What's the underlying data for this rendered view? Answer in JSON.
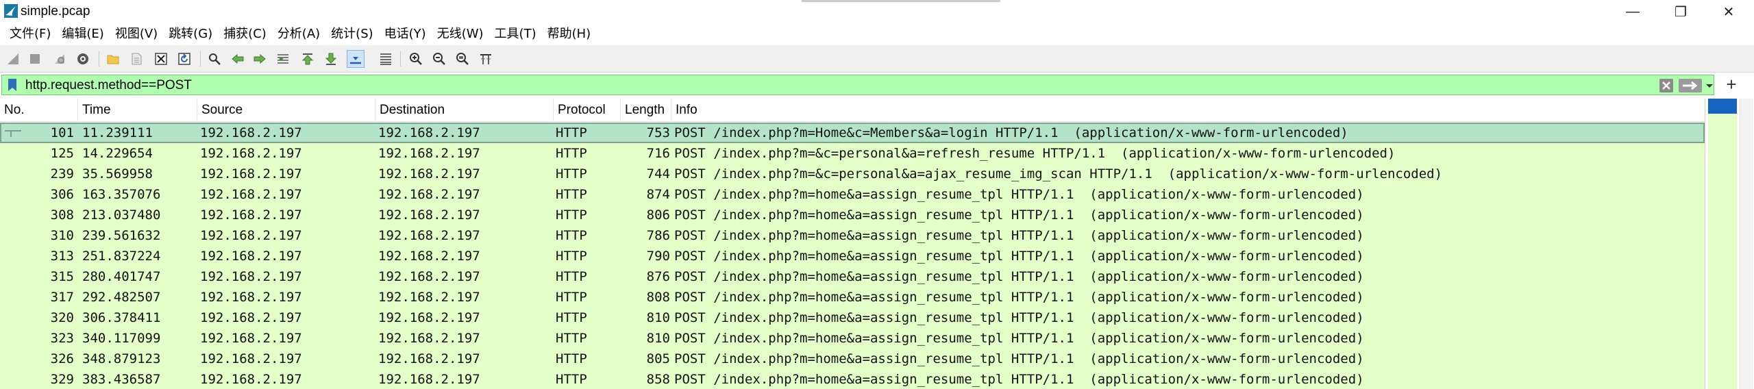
{
  "window": {
    "title": "simple.pcap",
    "minimize": "—",
    "maximize": "❐",
    "close": "✕"
  },
  "menu": [
    "文件(F)",
    "编辑(E)",
    "视图(V)",
    "跳转(G)",
    "捕获(C)",
    "分析(A)",
    "统计(S)",
    "电话(Y)",
    "无线(W)",
    "工具(T)",
    "帮助(H)"
  ],
  "toolbar_icons": [
    "shark-fin-start-icon",
    "stop-icon",
    "restart-icon",
    "capture-options-icon",
    "open-folder-icon",
    "file-icon",
    "close-file-icon",
    "reload-icon",
    "find-icon",
    "back-icon",
    "forward-icon",
    "goto-packet-icon",
    "first-packet-icon",
    "last-packet-icon",
    "autoscroll-icon",
    "colorize-icon",
    "zoom-in-icon",
    "zoom-out-icon",
    "zoom-reset-icon",
    "resize-columns-icon"
  ],
  "filter": {
    "value": "http.request.method==POST",
    "background": "#afffaf"
  },
  "columns": [
    "No.",
    "Time",
    "Source",
    "Destination",
    "Protocol",
    "Length",
    "Info"
  ],
  "colors": {
    "row_bg": "#e4ffc7",
    "selected_bg": "#b3e4c8",
    "minimap_mark": "#1565c0"
  },
  "packets": [
    {
      "no": "101",
      "time": "11.239111",
      "src": "192.168.2.197",
      "dst": "192.168.2.197",
      "proto": "HTTP",
      "len": "753",
      "info": "POST /index.php?m=Home&c=Members&a=login HTTP/1.1  (application/x-www-form-urlencoded)"
    },
    {
      "no": "125",
      "time": "14.229654",
      "src": "192.168.2.197",
      "dst": "192.168.2.197",
      "proto": "HTTP",
      "len": "716",
      "info": "POST /index.php?m=&c=personal&a=refresh_resume HTTP/1.1  (application/x-www-form-urlencoded)"
    },
    {
      "no": "239",
      "time": "35.569958",
      "src": "192.168.2.197",
      "dst": "192.168.2.197",
      "proto": "HTTP",
      "len": "744",
      "info": "POST /index.php?m=&c=personal&a=ajax_resume_img_scan HTTP/1.1  (application/x-www-form-urlencoded)"
    },
    {
      "no": "306",
      "time": "163.357076",
      "src": "192.168.2.197",
      "dst": "192.168.2.197",
      "proto": "HTTP",
      "len": "874",
      "info": "POST /index.php?m=home&a=assign_resume_tpl HTTP/1.1  (application/x-www-form-urlencoded)"
    },
    {
      "no": "308",
      "time": "213.037480",
      "src": "192.168.2.197",
      "dst": "192.168.2.197",
      "proto": "HTTP",
      "len": "806",
      "info": "POST /index.php?m=home&a=assign_resume_tpl HTTP/1.1  (application/x-www-form-urlencoded)"
    },
    {
      "no": "310",
      "time": "239.561632",
      "src": "192.168.2.197",
      "dst": "192.168.2.197",
      "proto": "HTTP",
      "len": "786",
      "info": "POST /index.php?m=home&a=assign_resume_tpl HTTP/1.1  (application/x-www-form-urlencoded)"
    },
    {
      "no": "313",
      "time": "251.837224",
      "src": "192.168.2.197",
      "dst": "192.168.2.197",
      "proto": "HTTP",
      "len": "790",
      "info": "POST /index.php?m=home&a=assign_resume_tpl HTTP/1.1  (application/x-www-form-urlencoded)"
    },
    {
      "no": "315",
      "time": "280.401747",
      "src": "192.168.2.197",
      "dst": "192.168.2.197",
      "proto": "HTTP",
      "len": "876",
      "info": "POST /index.php?m=home&a=assign_resume_tpl HTTP/1.1  (application/x-www-form-urlencoded)"
    },
    {
      "no": "317",
      "time": "292.482507",
      "src": "192.168.2.197",
      "dst": "192.168.2.197",
      "proto": "HTTP",
      "len": "808",
      "info": "POST /index.php?m=home&a=assign_resume_tpl HTTP/1.1  (application/x-www-form-urlencoded)"
    },
    {
      "no": "320",
      "time": "306.378411",
      "src": "192.168.2.197",
      "dst": "192.168.2.197",
      "proto": "HTTP",
      "len": "810",
      "info": "POST /index.php?m=home&a=assign_resume_tpl HTTP/1.1  (application/x-www-form-urlencoded)"
    },
    {
      "no": "323",
      "time": "340.117099",
      "src": "192.168.2.197",
      "dst": "192.168.2.197",
      "proto": "HTTP",
      "len": "810",
      "info": "POST /index.php?m=home&a=assign_resume_tpl HTTP/1.1  (application/x-www-form-urlencoded)"
    },
    {
      "no": "326",
      "time": "348.879123",
      "src": "192.168.2.197",
      "dst": "192.168.2.197",
      "proto": "HTTP",
      "len": "805",
      "info": "POST /index.php?m=home&a=assign_resume_tpl HTTP/1.1  (application/x-www-form-urlencoded)"
    },
    {
      "no": "329",
      "time": "383.436587",
      "src": "192.168.2.197",
      "dst": "192.168.2.197",
      "proto": "HTTP",
      "len": "858",
      "info": "POST /index.php?m=home&a=assign_resume_tpl HTTP/1.1  (application/x-www-form-urlencoded)"
    }
  ]
}
